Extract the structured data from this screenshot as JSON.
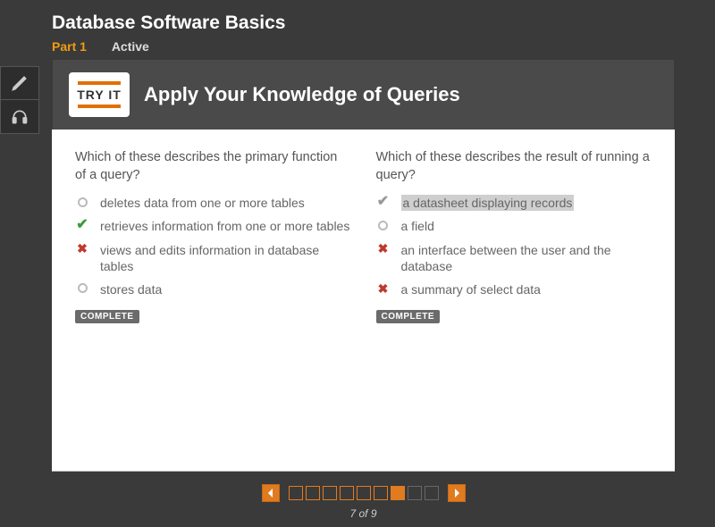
{
  "header": {
    "title": "Database Software Basics",
    "part_label": "Part 1",
    "active_label": "Active"
  },
  "card": {
    "tryit_label": "TRY IT",
    "title": "Apply Your Knowledge of Queries"
  },
  "questions": [
    {
      "prompt": "Which of these describes the primary function of a query?",
      "options": [
        {
          "marker": "empty",
          "text": "deletes data from one or more tables",
          "selected": false
        },
        {
          "marker": "check-green",
          "text": "retrieves information from one or more tables",
          "selected": false
        },
        {
          "marker": "cross",
          "text": "views and edits information in database tables",
          "selected": false
        },
        {
          "marker": "empty",
          "text": "stores data",
          "selected": false
        }
      ],
      "status": "COMPLETE"
    },
    {
      "prompt": "Which of these describes the result of running a query?",
      "options": [
        {
          "marker": "check-grey",
          "text": "a datasheet displaying records",
          "selected": true
        },
        {
          "marker": "empty",
          "text": "a field",
          "selected": false
        },
        {
          "marker": "cross",
          "text": "an interface between the user and the database",
          "selected": false
        },
        {
          "marker": "cross",
          "text": "a summary of select data",
          "selected": false
        }
      ],
      "status": "COMPLETE"
    }
  ],
  "pager": {
    "total": 9,
    "current": 7,
    "label": "7 of 9"
  }
}
